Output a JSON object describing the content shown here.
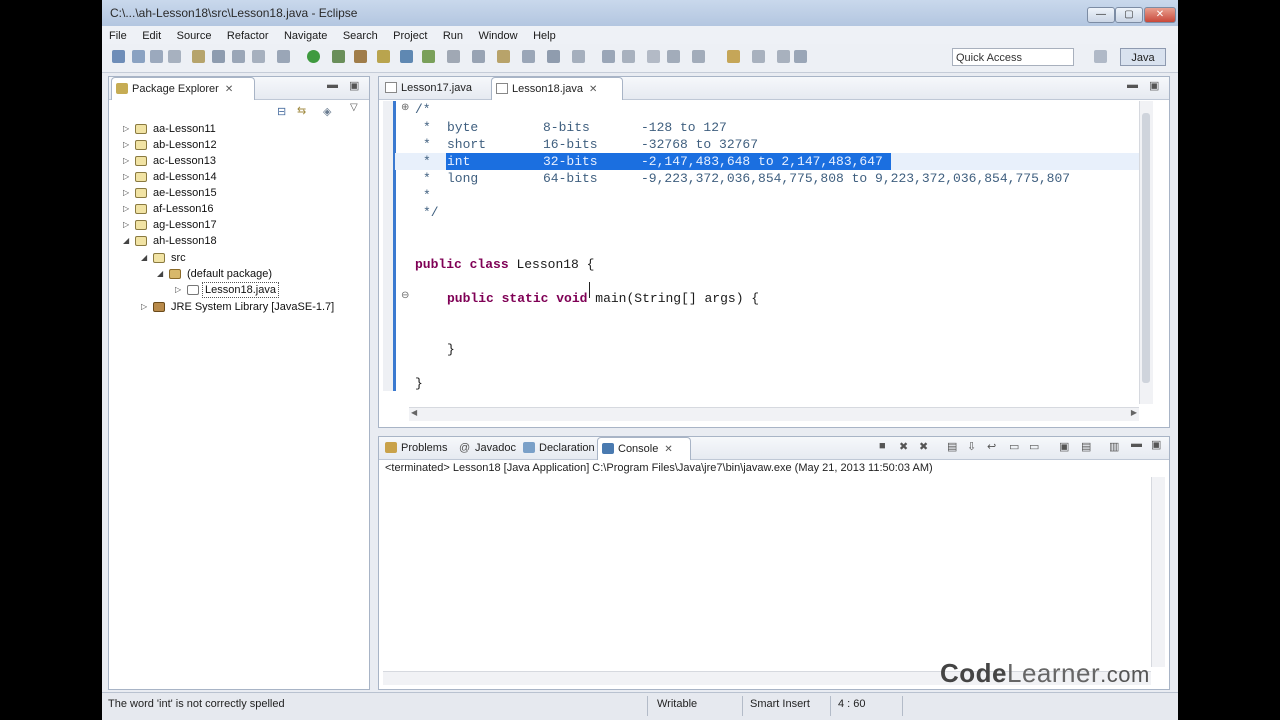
{
  "window": {
    "title": "C:\\...\\ah-Lesson18\\src\\Lesson18.java - Eclipse",
    "controls": [
      "minimize",
      "maximize",
      "close"
    ]
  },
  "menu": [
    "File",
    "Edit",
    "Source",
    "Refactor",
    "Navigate",
    "Search",
    "Project",
    "Run",
    "Window",
    "Help"
  ],
  "toolbar": {
    "quick_access": "Quick Access",
    "perspective": "Java"
  },
  "package_explorer": {
    "title": "Package Explorer",
    "projects": [
      "aa-Lesson11",
      "ab-Lesson12",
      "ac-Lesson13",
      "ad-Lesson14",
      "ae-Lesson15",
      "af-Lesson16",
      "ag-Lesson17",
      "ah-Lesson18"
    ],
    "src": "src",
    "default_package": "(default package)",
    "file": "Lesson18.java",
    "jre": "JRE System Library [JavaSE-1.7]"
  },
  "editor": {
    "tabs": [
      "Lesson17.java",
      "Lesson18.java"
    ],
    "code": {
      "l1": "/*",
      "rows": [
        {
          "type": "byte",
          "bits": "8-bits",
          "range": "-128 to 127"
        },
        {
          "type": "short",
          "bits": "16-bits",
          "range": "-32768 to 32767"
        },
        {
          "type": "int",
          "bits": "32-bits",
          "range": "-2,147,483,648 to 2,147,483,647"
        },
        {
          "type": "long",
          "bits": "64-bits",
          "range": "-9,223,372,036,854,775,808 to 9,223,372,036,854,775,807"
        }
      ],
      "star": "*",
      "end_comment": "*/",
      "kw_public": "public",
      "kw_class": "class",
      "class_name": "Lesson18 {",
      "kw_static": "static",
      "kw_void": "void",
      "main_sig": "main(String[] args) {",
      "close_inner": "}",
      "close_outer": "}"
    }
  },
  "bottom": {
    "tabs": [
      "Problems",
      "Javadoc",
      "Declaration",
      "Console"
    ],
    "console_status": "<terminated> Lesson18 [Java Application] C:\\Program Files\\Java\\jre7\\bin\\javaw.exe (May 21, 2013 11:50:03 AM)"
  },
  "status": {
    "message": "The word 'int' is not correctly spelled",
    "writable": "Writable",
    "insert_mode": "Smart Insert",
    "position": "4 : 60"
  },
  "watermark": {
    "code": "Code",
    "learner": "Learner",
    "com": ".com"
  }
}
